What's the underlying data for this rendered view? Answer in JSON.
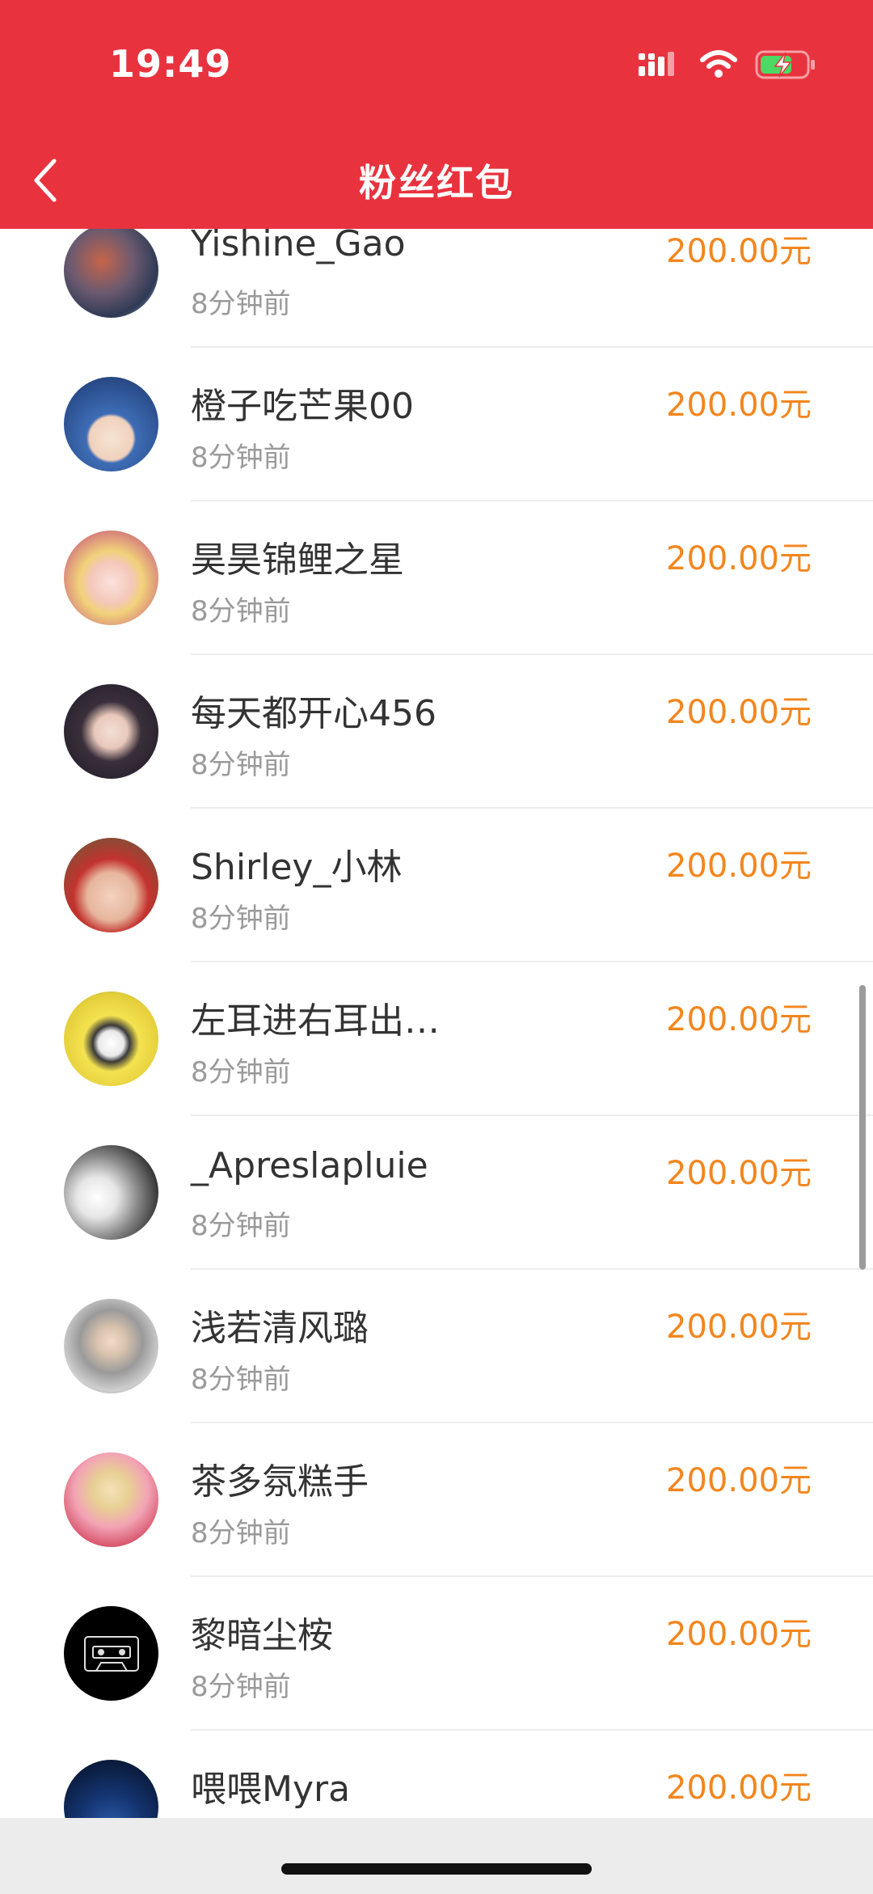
{
  "status_bar": {
    "time": "19:49",
    "icons": [
      "cellular-signal-icon",
      "wifi-icon",
      "battery-charging-icon"
    ]
  },
  "nav": {
    "title": "粉丝红包",
    "back_icon": "chevron-left-icon"
  },
  "colors": {
    "header_bg": "#e8333f",
    "amount": "#f2861e",
    "battery": "#4cd964"
  },
  "list": {
    "items": [
      {
        "name": "Yishine_Gao",
        "time": "8分钟前",
        "amount": "200.00元"
      },
      {
        "name": "橙子吃芒果00",
        "time": "8分钟前",
        "amount": "200.00元"
      },
      {
        "name": "昊昊锦鲤之星",
        "time": "8分钟前",
        "amount": "200.00元"
      },
      {
        "name": "每天都开心456",
        "time": "8分钟前",
        "amount": "200.00元"
      },
      {
        "name": "Shirley_小林",
        "time": "8分钟前",
        "amount": "200.00元"
      },
      {
        "name": "左耳进右耳出…",
        "time": "8分钟前",
        "amount": "200.00元"
      },
      {
        "name": "_Apreslapluie",
        "time": "8分钟前",
        "amount": "200.00元"
      },
      {
        "name": "浅若清风璐",
        "time": "8分钟前",
        "amount": "200.00元"
      },
      {
        "name": "茶多氛糕手",
        "time": "8分钟前",
        "amount": "200.00元"
      },
      {
        "name": "黎暗尘桉",
        "time": "8分钟前",
        "amount": "200.00元"
      },
      {
        "name": "喂喂Myra",
        "time": "",
        "amount": "200.00元"
      }
    ]
  }
}
